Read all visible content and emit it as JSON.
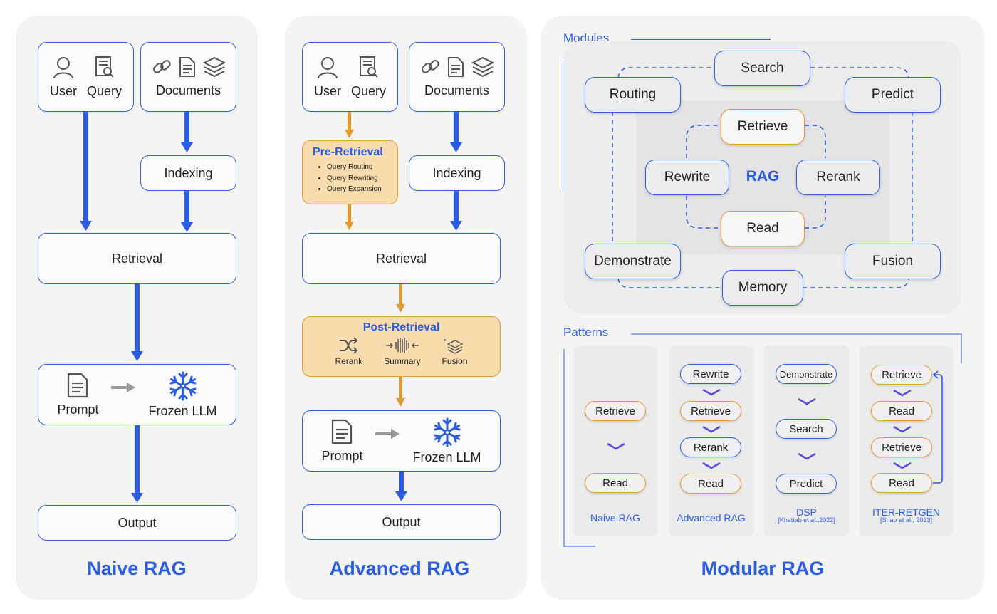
{
  "naive": {
    "title": "Naive RAG",
    "user": "User",
    "query": "Query",
    "documents": "Documents",
    "indexing": "Indexing",
    "retrieval": "Retrieval",
    "prompt": "Prompt",
    "frozen_llm": "Frozen LLM",
    "output": "Output"
  },
  "advanced": {
    "title": "Advanced RAG",
    "user": "User",
    "query": "Query",
    "documents": "Documents",
    "indexing": "Indexing",
    "pre_retrieval": {
      "title": "Pre-Retrieval",
      "items": [
        "Query Routing",
        "Query Rewriting",
        "Query Expansion"
      ]
    },
    "retrieval": "Retrieval",
    "post_retrieval": {
      "title": "Post-Retrieval",
      "items": [
        "Rerank",
        "Summary",
        "Fusion"
      ]
    },
    "prompt": "Prompt",
    "frozen_llm": "Frozen LLM",
    "output": "Output"
  },
  "modular": {
    "title": "Modular RAG",
    "modules_label": "Modules",
    "center_label": "RAG",
    "outer_modules": [
      "Search",
      "Routing",
      "Predict",
      "Demonstrate",
      "Fusion",
      "Memory"
    ],
    "inner_modules": [
      "Retrieve",
      "Rewrite",
      "Rerank",
      "Read"
    ],
    "patterns_label": "Patterns",
    "patterns": [
      {
        "name": "Naive RAG",
        "cite": "",
        "steps": [
          "Retrieve",
          "Read"
        ]
      },
      {
        "name": "Advanced RAG",
        "cite": "",
        "steps": [
          "Rewrite",
          "Retrieve",
          "Rerank",
          "Read"
        ]
      },
      {
        "name": "DSP",
        "cite": "[Khattab et al.,2022]",
        "steps": [
          "Demonstrate",
          "Search",
          "Predict"
        ]
      },
      {
        "name": "ITER-RETGEN",
        "cite": "[Shao et al., 2023]",
        "steps": [
          "Retrieve",
          "Read",
          "Retrieve",
          "Read"
        ]
      }
    ]
  },
  "colors": {
    "accent": "#2a5ce6",
    "orange": "#e69a2e",
    "orange_fill": "#f8dcae",
    "panel": "#f4f4f5"
  }
}
